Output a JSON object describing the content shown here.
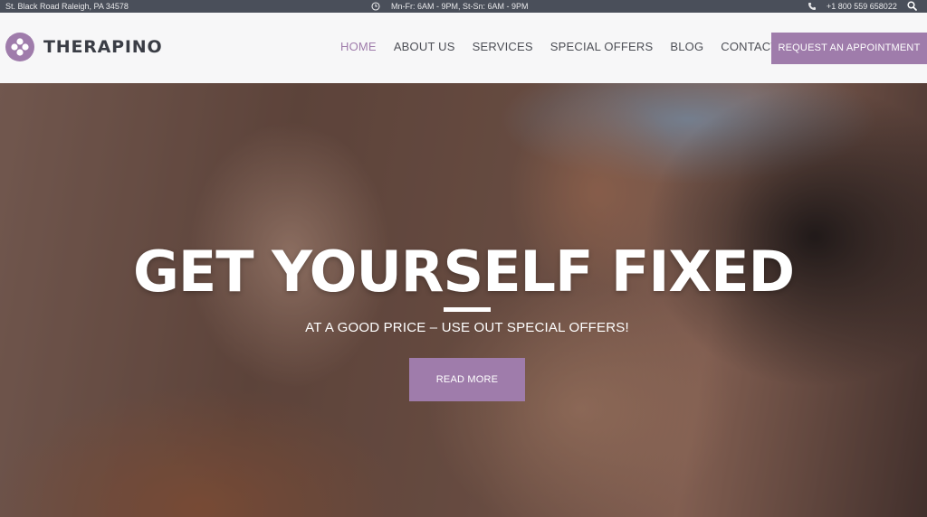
{
  "colors": {
    "accent": "#9f7cab",
    "topbar_bg": "#4a4f5a",
    "header_bg": "#f7f7f8"
  },
  "topbar": {
    "address": "St. Black Road Raleigh, PA 34578",
    "hours": "Mn-Fr: 6AM - 9PM, St-Sn: 6AM - 9PM",
    "phone": "+1 800 559 658022",
    "icons": {
      "clock": "clock-icon",
      "phone": "phone-icon",
      "search": "search-icon"
    }
  },
  "header": {
    "logo_text": "THERAPINO",
    "nav": [
      {
        "label": "HOME",
        "active": true
      },
      {
        "label": "ABOUT US",
        "active": false
      },
      {
        "label": "SERVICES",
        "active": false
      },
      {
        "label": "SPECIAL OFFERS",
        "active": false
      },
      {
        "label": "BLOG",
        "active": false
      },
      {
        "label": "CONTACTS",
        "active": false
      }
    ],
    "cta_label": "REQUEST AN APPOINTMENT"
  },
  "hero": {
    "title": "GET YOURSELF FIXED",
    "subtitle": "AT A GOOD PRICE – USE OUT SPECIAL OFFERS!",
    "button_label": "READ MORE"
  }
}
